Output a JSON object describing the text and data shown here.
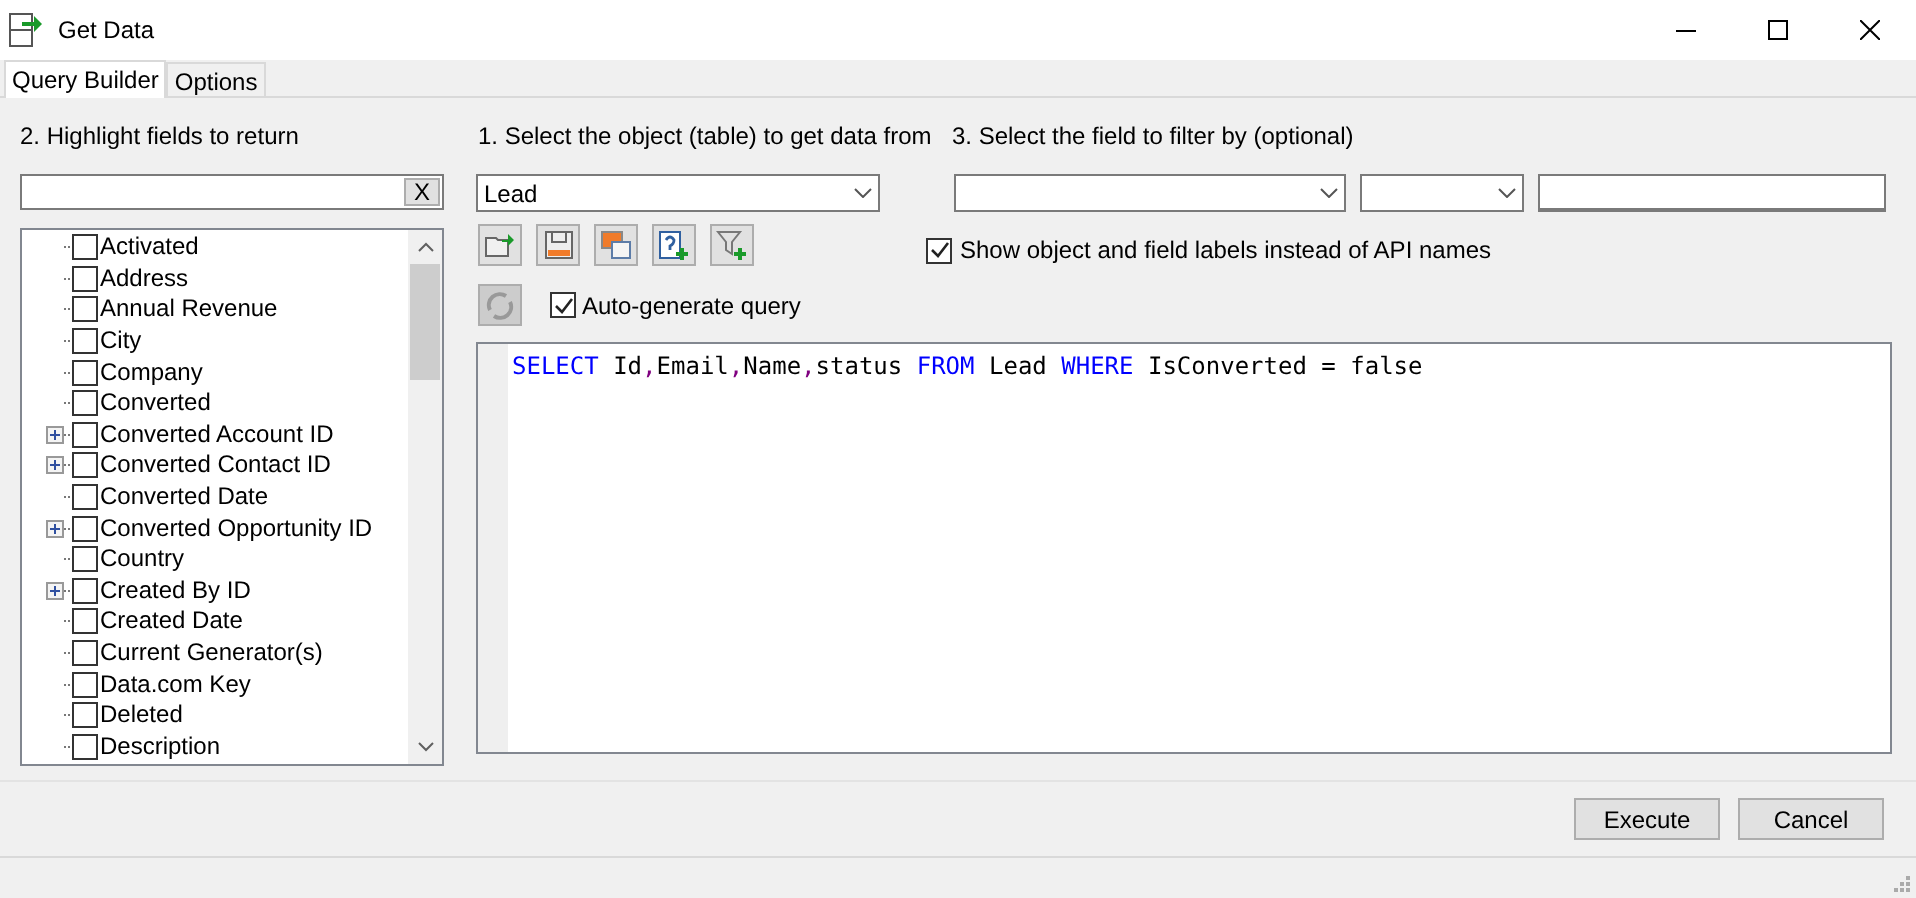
{
  "window": {
    "title": "Get Data"
  },
  "tabs": [
    {
      "label": "Query Builder",
      "selected": true
    },
    {
      "label": "Options",
      "selected": false
    }
  ],
  "fields_panel": {
    "label": "2. Highlight fields to return",
    "search_clear": "X",
    "fields": [
      {
        "label": "Activated",
        "checked": false,
        "expandable": false
      },
      {
        "label": "Address",
        "checked": false,
        "expandable": false
      },
      {
        "label": "Annual Revenue",
        "checked": false,
        "expandable": false
      },
      {
        "label": "City",
        "checked": false,
        "expandable": false
      },
      {
        "label": "Company",
        "checked": false,
        "expandable": false
      },
      {
        "label": "Converted",
        "checked": false,
        "expandable": false
      },
      {
        "label": "Converted Account ID",
        "checked": false,
        "expandable": true
      },
      {
        "label": "Converted Contact ID",
        "checked": false,
        "expandable": true
      },
      {
        "label": "Converted Date",
        "checked": false,
        "expandable": false
      },
      {
        "label": "Converted Opportunity ID",
        "checked": false,
        "expandable": true
      },
      {
        "label": "Country",
        "checked": false,
        "expandable": false
      },
      {
        "label": "Created By ID",
        "checked": false,
        "expandable": true
      },
      {
        "label": "Created Date",
        "checked": false,
        "expandable": false
      },
      {
        "label": "Current Generator(s)",
        "checked": false,
        "expandable": false
      },
      {
        "label": "Data.com Key",
        "checked": false,
        "expandable": false
      },
      {
        "label": "Deleted",
        "checked": false,
        "expandable": false
      },
      {
        "label": "Description",
        "checked": false,
        "expandable": false
      }
    ]
  },
  "object_panel": {
    "label": "1. Select the object (table) to get data from",
    "object": "Lead",
    "auto_generate": {
      "label": "Auto-generate query",
      "checked": true
    }
  },
  "filter_panel": {
    "label": "3. Select the field to filter by (optional)",
    "show_labels": {
      "label": "Show object and field labels instead of API names",
      "checked": true
    }
  },
  "query": [
    {
      "text": "SELECT",
      "kind": "keyword"
    },
    {
      "text": " Id",
      "kind": "ident"
    },
    {
      "text": ",",
      "kind": "punct"
    },
    {
      "text": "Email",
      "kind": "ident"
    },
    {
      "text": ",",
      "kind": "punct"
    },
    {
      "text": "Name",
      "kind": "ident"
    },
    {
      "text": ",",
      "kind": "punct"
    },
    {
      "text": "status ",
      "kind": "ident"
    },
    {
      "text": "FROM",
      "kind": "keyword"
    },
    {
      "text": " Lead ",
      "kind": "ident"
    },
    {
      "text": "WHERE",
      "kind": "keyword"
    },
    {
      "text": " IsConverted = false",
      "kind": "ident"
    }
  ],
  "buttons": [
    "Execute",
    "Cancel"
  ]
}
